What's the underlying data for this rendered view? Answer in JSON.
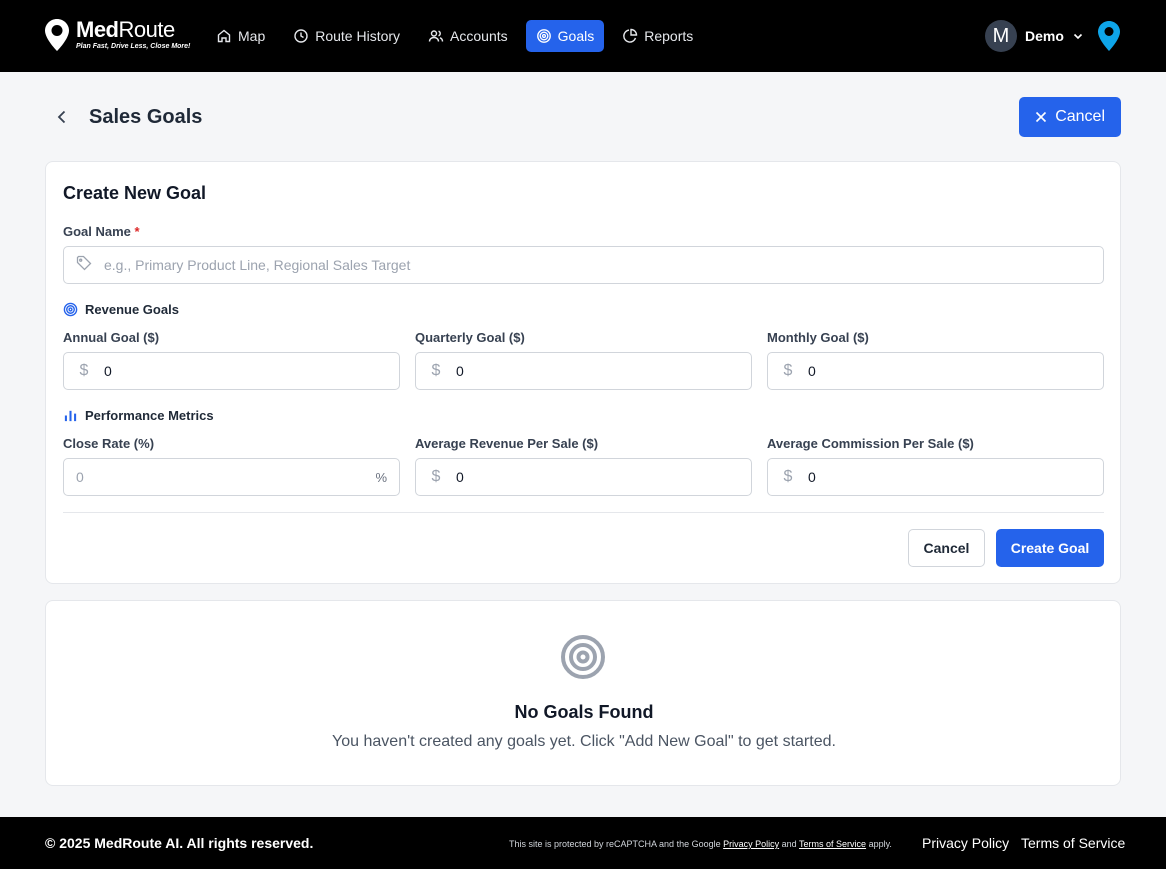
{
  "header": {
    "logo_name_bold": "Med",
    "logo_name_light": "Route",
    "logo_tagline": "Plan Fast, Drive Less, Close More!",
    "nav": [
      {
        "label": "Map",
        "icon": "home-icon",
        "active": false
      },
      {
        "label": "Route History",
        "icon": "clock-icon",
        "active": false
      },
      {
        "label": "Accounts",
        "icon": "users-icon",
        "active": false
      },
      {
        "label": "Goals",
        "icon": "target-icon",
        "active": true
      },
      {
        "label": "Reports",
        "icon": "pie-chart-icon",
        "active": false
      }
    ],
    "user_initial": "M",
    "user_name": "Demo"
  },
  "page": {
    "title": "Sales Goals",
    "cancel_label": "Cancel"
  },
  "form": {
    "title": "Create New Goal",
    "goal_name_label": "Goal Name",
    "required_marker": "*",
    "goal_name_placeholder": "e.g., Primary Product Line, Regional Sales Target",
    "revenue_section": "Revenue Goals",
    "annual_label": "Annual Goal ($)",
    "annual_value": "0",
    "quarterly_label": "Quarterly Goal ($)",
    "quarterly_value": "0",
    "monthly_label": "Monthly Goal ($)",
    "monthly_value": "0",
    "metrics_section": "Performance Metrics",
    "close_rate_label": "Close Rate (%)",
    "close_rate_placeholder": "0",
    "close_rate_suffix": "%",
    "avg_rev_label": "Average Revenue Per Sale ($)",
    "avg_rev_value": "0",
    "avg_comm_label": "Average Commission Per Sale ($)",
    "avg_comm_value": "0",
    "currency_symbol": "$",
    "cancel_label": "Cancel",
    "create_label": "Create Goal"
  },
  "empty": {
    "title": "No Goals Found",
    "message": "You haven't created any goals yet. Click \"Add New Goal\" to get started."
  },
  "footer": {
    "copyright": "© 2025 MedRoute AI. All rights reserved.",
    "recaptcha_prefix": "This site is protected by reCAPTCHA and the Google",
    "recaptcha_privacy": "Privacy Policy",
    "recaptcha_and": "and",
    "recaptcha_terms": "Terms of Service",
    "recaptcha_suffix": "apply.",
    "privacy_label": "Privacy Policy",
    "terms_label": "Terms of Service"
  },
  "colors": {
    "accent": "#2563eb",
    "header_bg": "#000000",
    "page_bg": "#f5f6f8",
    "required": "#dc2626",
    "pin": "#0ea5e9"
  }
}
